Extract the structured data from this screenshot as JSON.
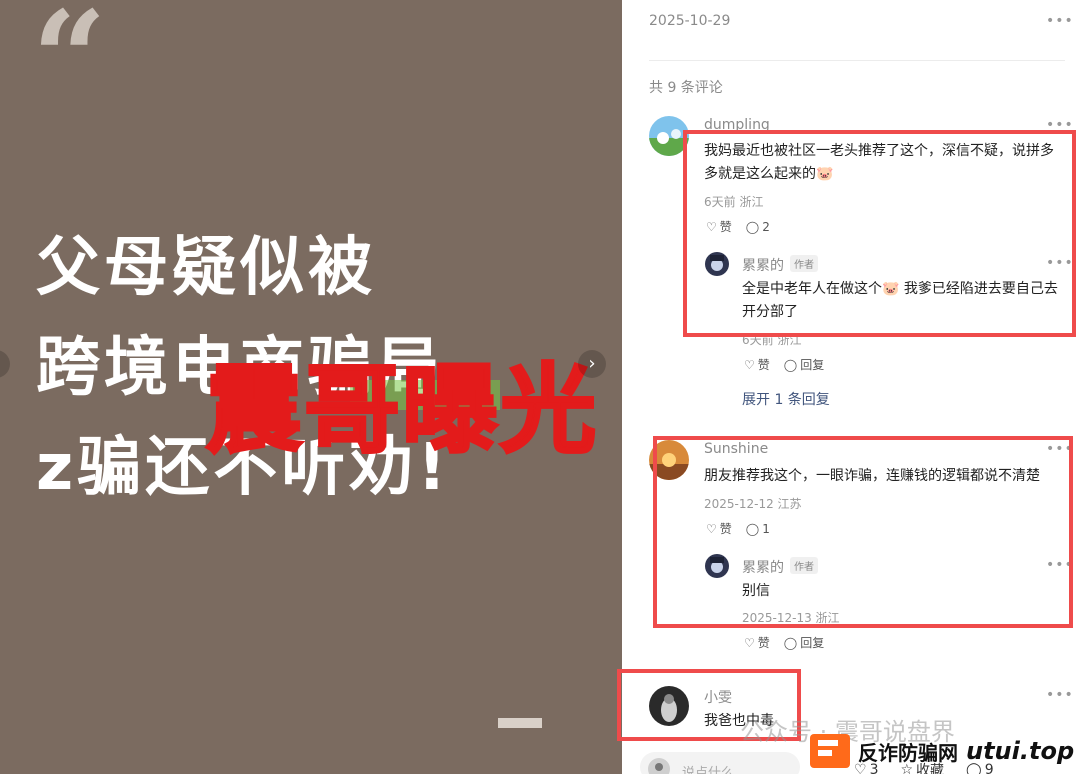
{
  "left_image": {
    "quote_mark": "“",
    "headline_lines": [
      "父母疑似被",
      "跨境电商骗局",
      "z骗还不听劝!"
    ],
    "stamp_text": "震哥曝光"
  },
  "post": {
    "date": "2025-10-29"
  },
  "comments_header": {
    "count_text": "共 9 条评论"
  },
  "comments": [
    {
      "name": "dumpling",
      "text": "我妈最近也被社区一老头推荐了这个，深信不疑，说拼多多就是这么起来的🐷",
      "meta": "6天前 浙江",
      "like": "赞",
      "reply_count": "2",
      "reply": {
        "name": "累累的",
        "badge": "作者",
        "text": "全是中老年人在做这个🐷 我爹已经陷进去要自己去开分部了",
        "meta": "6天前 浙江",
        "like": "赞",
        "reply": "回复"
      },
      "expand": "展开 1 条回复"
    },
    {
      "name": "Sunshine",
      "text": "朋友推荐我这个，一眼诈骗，连赚钱的逻辑都说不清楚",
      "meta": "2025-12-12 江苏",
      "like": "赞",
      "reply_count": "1",
      "reply": {
        "name": "累累的",
        "badge": "作者",
        "text": "别信",
        "meta": "2025-12-13 浙江",
        "like": "赞",
        "reply": "回复"
      }
    },
    {
      "name": "小雯",
      "text": "我爸也中毒"
    }
  ],
  "bottom_bar": {
    "placeholder": "说点什么...",
    "like_count": "3",
    "collect": "收藏",
    "comment_count": "9"
  },
  "watermark": "公众号 · 震哥说盘界",
  "brand": {
    "cn": "反诈防骗网",
    "en": "utui.top"
  },
  "colors": {
    "highlight_box": "#ef4b4b",
    "stamp": "#e31b1b",
    "image_bg": "#7b6b60"
  }
}
